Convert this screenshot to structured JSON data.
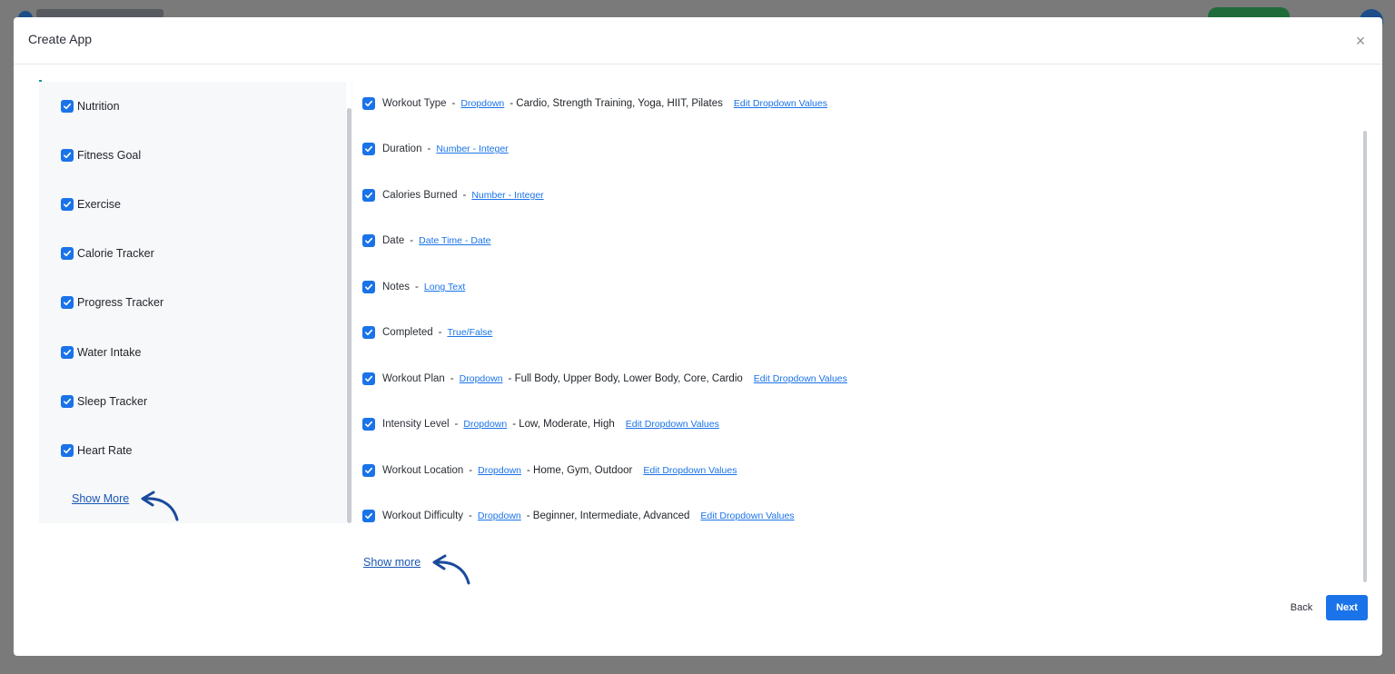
{
  "modal": {
    "title": "Create App",
    "close_glyph": "×"
  },
  "categories": [
    {
      "label": "Nutrition",
      "checked": true
    },
    {
      "label": "Fitness Goal",
      "checked": true
    },
    {
      "label": "Exercise",
      "checked": true
    },
    {
      "label": "Calorie Tracker",
      "checked": true
    },
    {
      "label": "Progress Tracker",
      "checked": true
    },
    {
      "label": "Water Intake",
      "checked": true
    },
    {
      "label": "Sleep Tracker",
      "checked": true
    },
    {
      "label": "Heart Rate",
      "checked": true
    }
  ],
  "left_show_more": "Show More",
  "fields": [
    {
      "name": "Workout Type",
      "type": "Dropdown",
      "values": "- Cardio, Strength Training, Yoga, HIIT, Pilates",
      "edit": "Edit Dropdown Values"
    },
    {
      "name": "Duration",
      "type": "Number - Integer"
    },
    {
      "name": "Calories Burned",
      "type": "Number - Integer"
    },
    {
      "name": "Date",
      "type": "Date Time - Date"
    },
    {
      "name": "Notes",
      "type": "Long Text"
    },
    {
      "name": "Completed",
      "type": "True/False"
    },
    {
      "name": "Workout Plan",
      "type": "Dropdown",
      "values": "- Full Body, Upper Body, Lower Body, Core, Cardio",
      "edit": "Edit Dropdown Values"
    },
    {
      "name": "Intensity Level",
      "type": "Dropdown",
      "values": "- Low, Moderate, High",
      "edit": "Edit Dropdown Values"
    },
    {
      "name": "Workout Location",
      "type": "Dropdown",
      "values": "- Home, Gym, Outdoor",
      "edit": "Edit Dropdown Values"
    },
    {
      "name": "Workout Difficulty",
      "type": "Dropdown",
      "values": "- Beginner, Intermediate, Advanced",
      "edit": "Edit Dropdown Values"
    }
  ],
  "field_separator": "-",
  "right_show_more": "Show more",
  "footer": {
    "back_label": "Back",
    "next_label": "Next"
  },
  "colors": {
    "accent": "#1a73e8",
    "annotation_arrow": "#1a4a9c"
  },
  "icons": {
    "checkbox": "check-icon",
    "close": "close-icon",
    "annotation": "curved-arrow-icon"
  }
}
